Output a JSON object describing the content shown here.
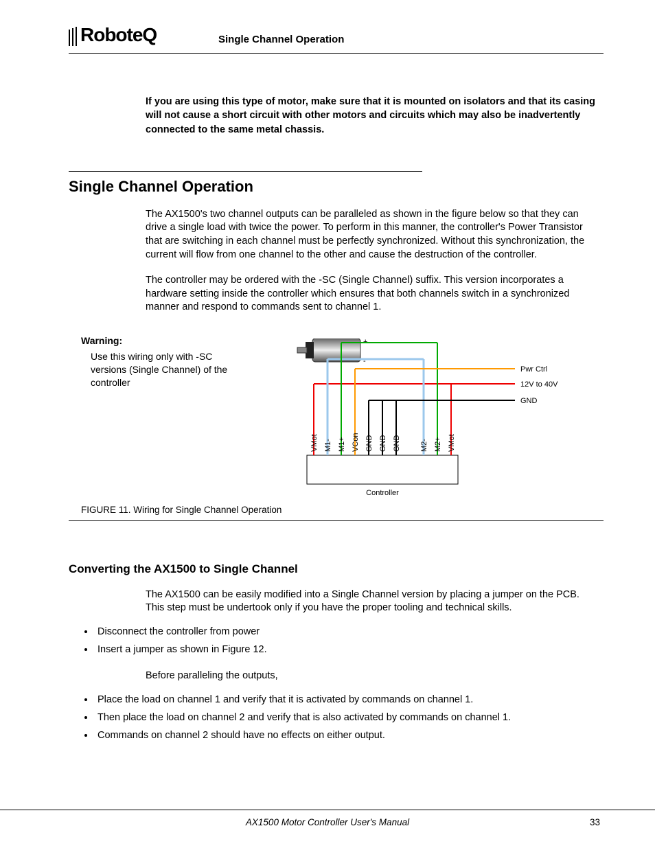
{
  "brand": "RoboteQ",
  "header_title": "Single Channel Operation",
  "intro_bold": "If you are using this type of motor, make sure that it is mounted on isolators and that its casing will not cause a short circuit with other motors and circuits which may also be inadvertently connected to the same metal chassis.",
  "section1": {
    "title": "Single Channel Operation",
    "p1": "The AX1500's two channel outputs can be paralleled as shown in the figure below so that they can drive a single load with twice the power. To perform in this manner, the controller's Power Transistor that are switching in each channel must be perfectly synchronized. Without this synchronization, the current will flow from one channel to the other and cause the destruction of the controller.",
    "p2": "The controller may be ordered with the -SC (Single Channel) suffix. This version incorporates a hardware setting inside the controller which ensures that both channels switch in a synchronized manner and respond to commands sent to channel 1."
  },
  "figure": {
    "warning_label": "Warning:",
    "warning_text": "Use this wiring only with -SC versions (Single Channel) of the controller",
    "labels_right": {
      "pwr": "Pwr Ctrl",
      "v12": "12V to 40V",
      "gnd": "GND"
    },
    "terminals": [
      "VMot",
      "M1-",
      "M1+",
      "VCon",
      "GND",
      "GND",
      "GND",
      "M2-",
      "M2+",
      "VMot"
    ],
    "controller": "Controller",
    "motor_plus": "+",
    "motor_minus": "-",
    "caption": "FIGURE 11.  Wiring for Single Channel Operation"
  },
  "section2": {
    "title": "Converting the AX1500 to Single Channel",
    "p1": "The AX1500 can be easily modified into a Single Channel version by placing a jumper on the PCB. This step must be undertook only if you have the proper tooling and technical skills.",
    "bullets1": [
      "Disconnect the controller from power",
      "Insert a jumper as shown in Figure 12."
    ],
    "p2": "Before paralleling the outputs,",
    "bullets2": [
      "Place the load on channel 1 and verify that it is activated by commands on channel 1.",
      "Then place the load on channel 2 and verify that is also activated by commands on channel 1.",
      "Commands on channel 2 should have no effects on either output."
    ]
  },
  "footer": {
    "title": "AX1500 Motor Controller User's Manual",
    "page": "33"
  }
}
